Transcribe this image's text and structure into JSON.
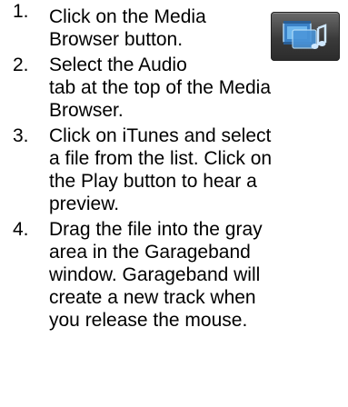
{
  "steps": [
    {
      "number": "1.",
      "text": "Click on the Media\nBrowser button."
    },
    {
      "number": "2.",
      "text": "Select the Audio\ntab at the top of the Media\nBrowser."
    },
    {
      "number": "3.",
      "text": "Click on iTunes and select\na file from the list.  Click on\nthe Play button to hear a\npreview."
    },
    {
      "number": "4.",
      "text": "Drag the file into the gray\narea in the Garageband\nwindow.  Garageband will\ncreate a new track when\nyou release the mouse."
    }
  ],
  "media_browser_button": {
    "icon": "media-browser-icon"
  },
  "colors": {
    "text": "#000000",
    "button_dark": "#2b2b2b",
    "icon_blue": "#5aa8e8"
  }
}
